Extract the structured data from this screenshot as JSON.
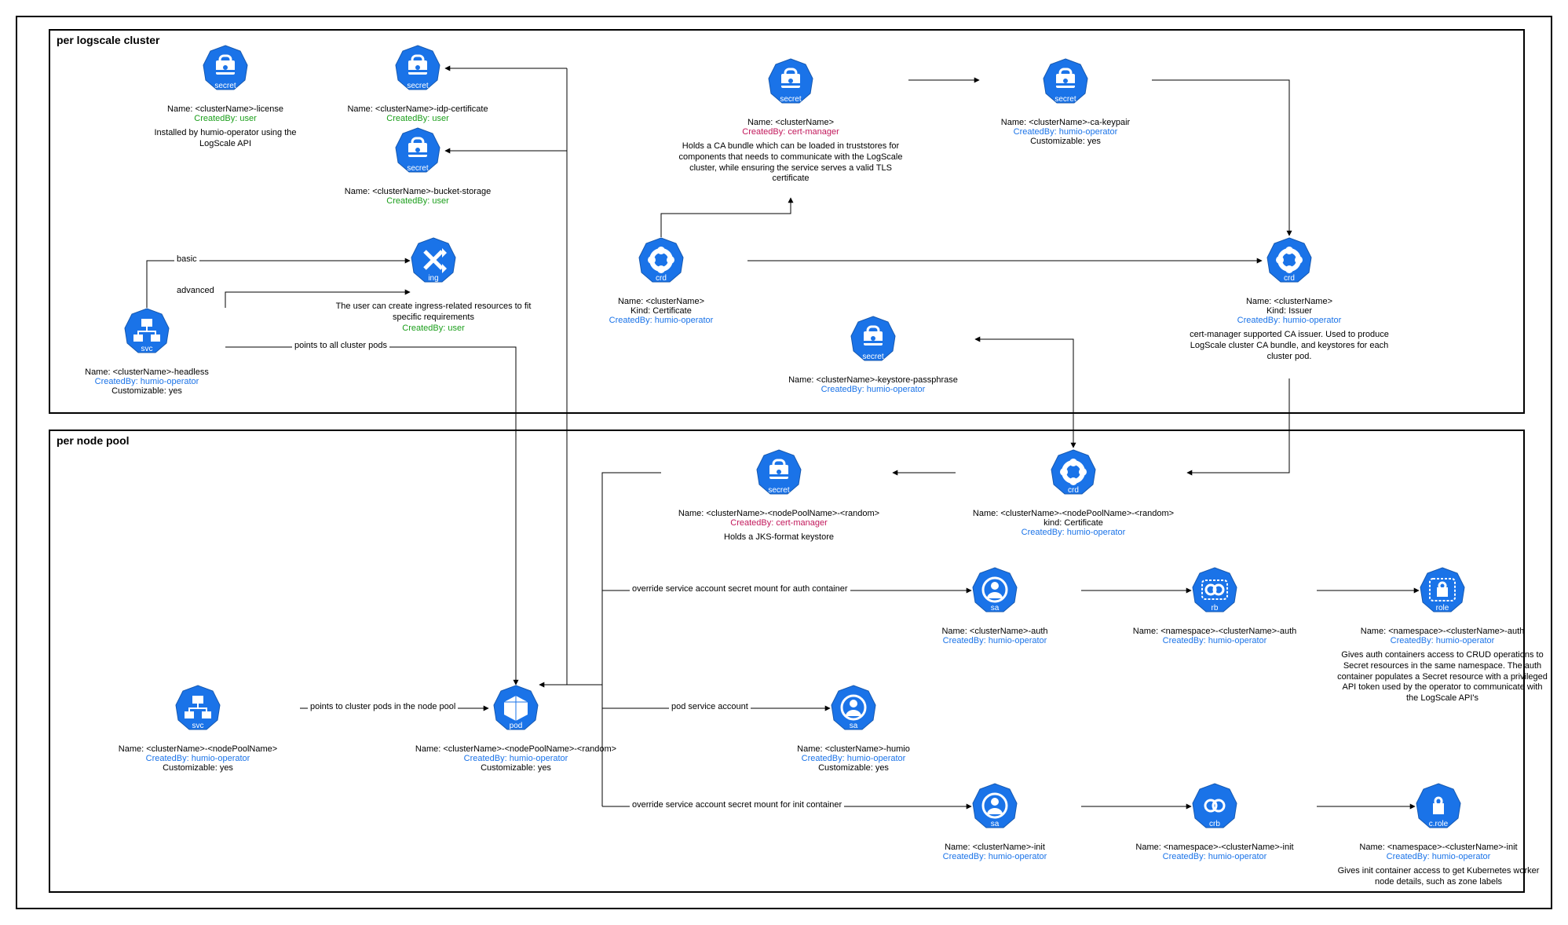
{
  "groups": {
    "cluster": {
      "label": "per logscale cluster"
    },
    "nodepool": {
      "label": "per node pool"
    }
  },
  "nodes": {
    "secret_license": {
      "type": "secret",
      "name": "Name: <clusterName>-license",
      "createdBy": "CreatedBy: user",
      "createdClass": "by-user",
      "desc": "Installed by humio-operator using the LogScale API"
    },
    "secret_idp": {
      "type": "secret",
      "name": "Name: <clusterName>-idp-certificate",
      "createdBy": "CreatedBy: user",
      "createdClass": "by-user"
    },
    "secret_bucket": {
      "type": "secret",
      "name": "Name: <clusterName>-bucket-storage",
      "createdBy": "CreatedBy: user",
      "createdClass": "by-user"
    },
    "secret_cluster": {
      "type": "secret",
      "name": "Name: <clusterName>",
      "createdBy": "CreatedBy: cert-manager",
      "createdClass": "by-cm",
      "desc": "Holds a CA bundle which can be loaded in truststores for components that needs to communicate with the LogScale cluster, while ensuring the service serves a valid TLS certificate"
    },
    "secret_cakey": {
      "type": "secret",
      "name": "Name: <clusterName>-ca-keypair",
      "createdBy": "CreatedBy: humio-operator",
      "createdClass": "by-hop",
      "custom": "Customizable: yes"
    },
    "secret_kspass": {
      "type": "secret",
      "name": "Name: <clusterName>-keystore-passphrase",
      "createdBy": "CreatedBy: humio-operator",
      "createdClass": "by-hop"
    },
    "ing": {
      "type": "ing",
      "desc": "The user can create ingress-related resources to fit specific requirements",
      "createdBy": "CreatedBy: user",
      "createdClass": "by-user"
    },
    "crd_cert": {
      "type": "crd",
      "name": "Name: <clusterName>",
      "kind": "Kind: Certificate",
      "createdBy": "CreatedBy: humio-operator",
      "createdClass": "by-hop"
    },
    "crd_issuer": {
      "type": "crd",
      "name": "Name: <clusterName>",
      "kind": "Kind: Issuer",
      "createdBy": "CreatedBy: humio-operator",
      "createdClass": "by-hop",
      "desc": "cert-manager supported CA issuer. Used to produce LogScale cluster CA bundle, and keystores for each cluster pod."
    },
    "svc_headless": {
      "type": "svc",
      "name": "Name: <clusterName>-headless",
      "createdBy": "CreatedBy: humio-operator",
      "createdClass": "by-hop",
      "custom": "Customizable: yes"
    },
    "secret_np": {
      "type": "secret",
      "name": "Name: <clusterName>-<nodePoolName>-<random>",
      "createdBy": "CreatedBy: cert-manager",
      "createdClass": "by-cm",
      "desc": "Holds a JKS-format keystore"
    },
    "crd_np": {
      "type": "crd",
      "name": "Name: <clusterName>-<nodePoolName>-<random>",
      "kind": "kind: Certificate",
      "createdBy": "CreatedBy: humio-operator",
      "createdClass": "by-hop"
    },
    "svc_np": {
      "type": "svc",
      "name": "Name: <clusterName>-<nodePoolName>",
      "createdBy": "CreatedBy: humio-operator",
      "createdClass": "by-hop",
      "custom": "Customizable: yes"
    },
    "pod": {
      "type": "pod",
      "name": "Name: <clusterName>-<nodePoolName>-<random>",
      "createdBy": "CreatedBy: humio-operator",
      "createdClass": "by-hop",
      "custom": "Customizable: yes"
    },
    "sa_auth": {
      "type": "sa",
      "name": "Name: <clusterName>-auth",
      "createdBy": "CreatedBy: humio-operator",
      "createdClass": "by-hop"
    },
    "rb_auth": {
      "type": "rb",
      "name": "Name: <namespace>-<clusterName>-auth",
      "createdBy": "CreatedBy: humio-operator",
      "createdClass": "by-hop"
    },
    "role_auth": {
      "type": "role",
      "name": "Name: <namespace>-<clusterName>-auth",
      "createdBy": "CreatedBy: humio-operator",
      "createdClass": "by-hop",
      "desc": "Gives auth containers access to CRUD operations to Secret resources in the same namespace. The auth container populates a Secret resource with a privileged API token used by the operator to communicate with the LogScale API's"
    },
    "sa_humio": {
      "type": "sa",
      "name": "Name: <clusterName>-humio",
      "createdBy": "CreatedBy: humio-operator",
      "createdClass": "by-hop",
      "custom": "Customizable: yes"
    },
    "sa_init": {
      "type": "sa",
      "name": "Name: <clusterName>-init",
      "createdBy": "CreatedBy: humio-operator",
      "createdClass": "by-hop"
    },
    "crb_init": {
      "type": "crb",
      "name": "Name: <namespace>-<clusterName>-init",
      "createdBy": "CreatedBy: humio-operator",
      "createdClass": "by-hop"
    },
    "crole_init": {
      "type": "crole",
      "name": "Name: <namespace>-<clusterName>-init",
      "createdBy": "CreatedBy: humio-operator",
      "createdClass": "by-hop",
      "desc": "Gives init container access to get Kubernetes worker node details, such as zone labels"
    }
  },
  "edgeLabels": {
    "basic": "basic",
    "advanced": "advanced",
    "allpods": "points to all cluster pods",
    "npods": "points to cluster pods in the node pool",
    "ovauth": "override service account secret mount for auth container",
    "psa": "pod service account",
    "ovinit": "override service account secret mount for init container"
  },
  "iconLabels": {
    "secret": "secret",
    "ing": "ing",
    "crd": "crd",
    "svc": "svc",
    "pod": "pod",
    "sa": "sa",
    "rb": "rb",
    "role": "role",
    "crb": "crb",
    "crole": "c.role"
  }
}
